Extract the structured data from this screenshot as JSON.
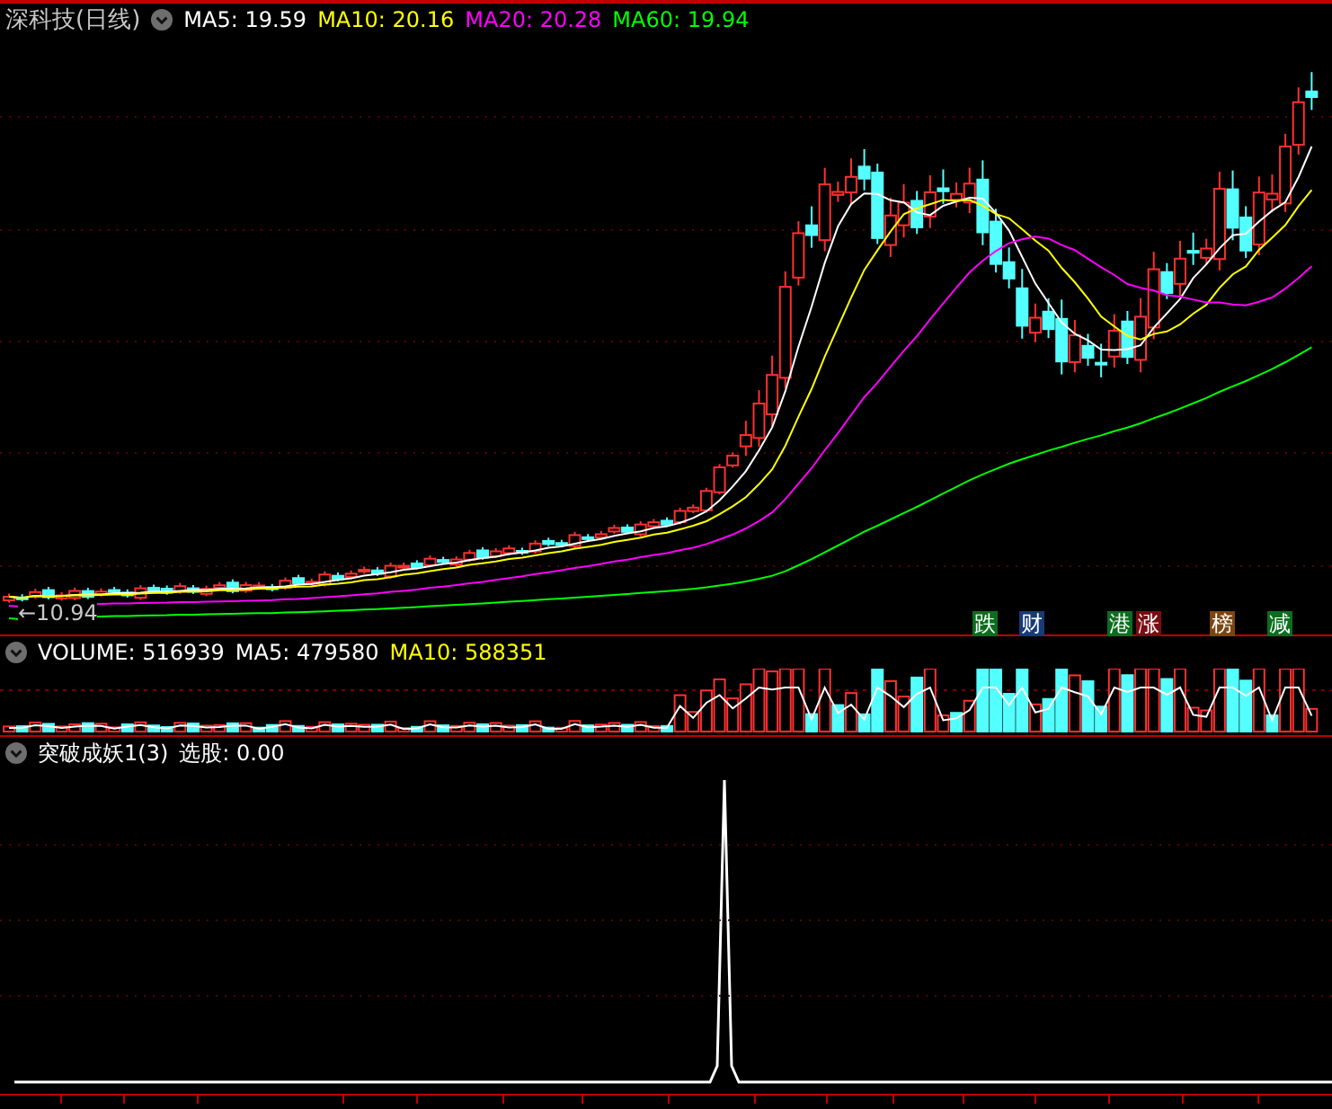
{
  "price_panel": {
    "title": "深科技(日线)",
    "indicators": [
      {
        "label": "MA5: 19.59",
        "color": "#ffffff"
      },
      {
        "label": "MA10: 20.16",
        "color": "#ffff00"
      },
      {
        "label": "MA20: 20.28",
        "color": "#ff00ff"
      },
      {
        "label": "MA60: 19.94",
        "color": "#00ff00"
      }
    ],
    "low_marker": "←10.94",
    "tags": [
      {
        "text": "跌",
        "color": "#0b6e1e"
      },
      {
        "text": "财",
        "color": "#173a78"
      },
      {
        "text": "港",
        "color": "#0b6e1e"
      },
      {
        "text": "涨",
        "color": "#7a0d12"
      },
      {
        "text": "榜",
        "color": "#7a4512"
      },
      {
        "text": "减",
        "color": "#0b6e1e"
      }
    ]
  },
  "volume_panel": {
    "indicators": [
      {
        "label": "VOLUME: 516939",
        "color": "#ffffff"
      },
      {
        "label": "MA5: 479580",
        "color": "#ffffff"
      },
      {
        "label": "MA10: 588351",
        "color": "#ffff00"
      }
    ]
  },
  "indicator_panel": {
    "title": "突破成妖1(3)",
    "indicators": [
      {
        "label": "选股: 0.00",
        "color": "#ffffff"
      }
    ]
  }
}
